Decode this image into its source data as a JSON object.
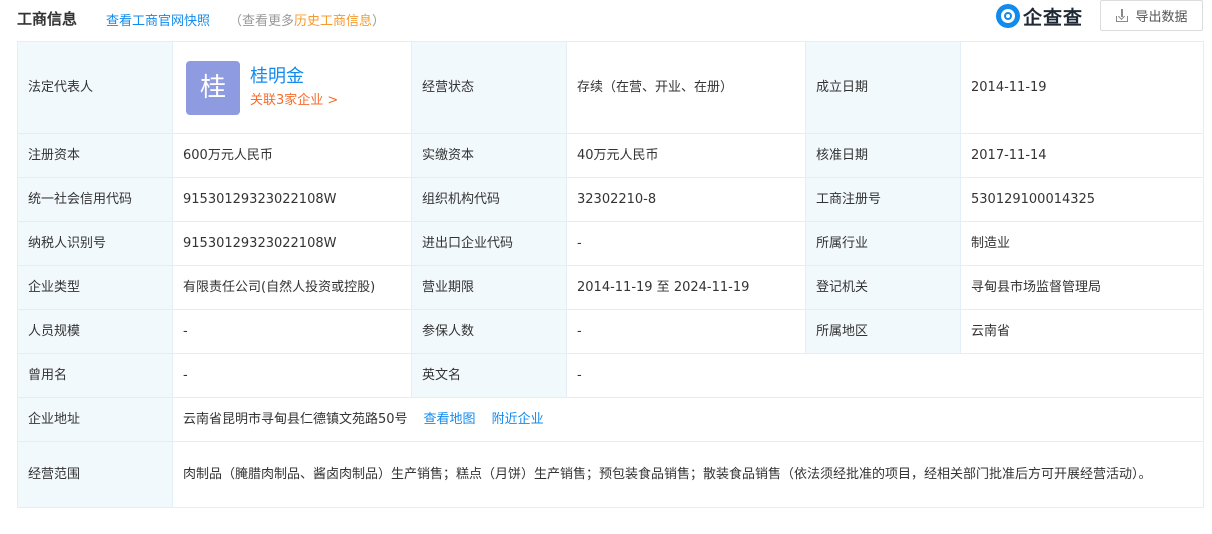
{
  "header": {
    "title": "工商信息",
    "snapshot_link": "查看工商官网快照",
    "history_prefix": "（查看更多",
    "history_link": "历史工商信息",
    "history_suffix": "）",
    "logo_text": "企查查",
    "export_label": "导出数据"
  },
  "info": {
    "legal_rep": {
      "label": "法定代表人",
      "avatar_char": "桂",
      "name": "桂明金",
      "related": "关联3家企业 >"
    },
    "rows": [
      [
        "经营状态",
        "存续（在营、开业、在册）",
        "成立日期",
        "2014-11-19"
      ],
      [
        "注册资本",
        "600万元人民币",
        "实缴资本",
        "40万元人民币",
        "核准日期",
        "2017-11-14"
      ],
      [
        "统一社会信用代码",
        "91530129323022108W",
        "组织机构代码",
        "32302210-8",
        "工商注册号",
        "530129100014325"
      ],
      [
        "纳税人识别号",
        "91530129323022108W",
        "进出口企业代码",
        "-",
        "所属行业",
        "制造业"
      ],
      [
        "企业类型",
        "有限责任公司(自然人投资或控股)",
        "营业期限",
        "2014-11-19 至 2024-11-19",
        "登记机关",
        "寻甸县市场监督管理局"
      ],
      [
        "人员规模",
        "-",
        "参保人数",
        "-",
        "所属地区",
        "云南省"
      ]
    ],
    "former_name": {
      "label": "曾用名",
      "value": "-",
      "en_label": "英文名",
      "en_value": "-"
    },
    "address": {
      "label": "企业地址",
      "value": "云南省昆明市寻甸县仁德镇文苑路50号",
      "map_link": "查看地图",
      "nearby_link": "附近企业"
    },
    "scope": {
      "label": "经营范围",
      "value": "肉制品（腌腊肉制品、酱卤肉制品）生产销售；糕点（月饼）生产销售；预包装食品销售；散装食品销售（依法须经批准的项目，经相关部门批准后方可开展经营活动）。"
    }
  },
  "colors": {
    "link": "#128bed",
    "label_bg": "#f2f9fc",
    "border": "#e4eef6",
    "avatar": "#8e9be0",
    "related": "#f56c2d",
    "history_highlight": "#f79a2d"
  }
}
